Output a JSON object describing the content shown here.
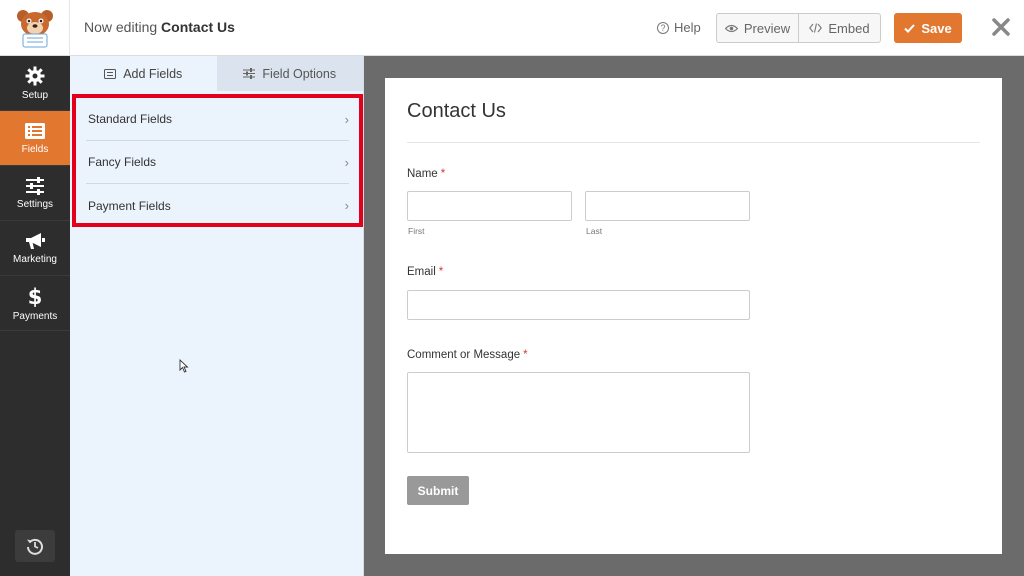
{
  "header": {
    "editing_prefix": "Now editing",
    "form_name": "Contact Us",
    "help_label": "Help",
    "preview_label": "Preview",
    "embed_label": "Embed",
    "save_label": "Save"
  },
  "nav": {
    "items": [
      {
        "label": "Setup",
        "icon": "gear-icon"
      },
      {
        "label": "Fields",
        "icon": "fields-list-icon",
        "active": true
      },
      {
        "label": "Settings",
        "icon": "sliders-icon"
      },
      {
        "label": "Marketing",
        "icon": "megaphone-icon"
      },
      {
        "label": "Payments",
        "icon": "dollar-icon"
      }
    ]
  },
  "panel": {
    "tabs": [
      {
        "label": "Add Fields",
        "icon": "list-icon",
        "active": true
      },
      {
        "label": "Field Options",
        "icon": "sliders-icon"
      }
    ],
    "groups": [
      "Standard Fields",
      "Fancy Fields",
      "Payment Fields"
    ]
  },
  "form": {
    "title": "Contact Us",
    "name_label": "Name",
    "first_sub": "First",
    "last_sub": "Last",
    "email_label": "Email",
    "message_label": "Comment or Message",
    "required_mark": "*",
    "submit_label": "Submit"
  },
  "colors": {
    "accent": "#e27730",
    "nav_bg": "#2d2d2d",
    "panel_bg": "#ebf3fc",
    "highlight": "#e3001b",
    "required": "#d63638"
  }
}
